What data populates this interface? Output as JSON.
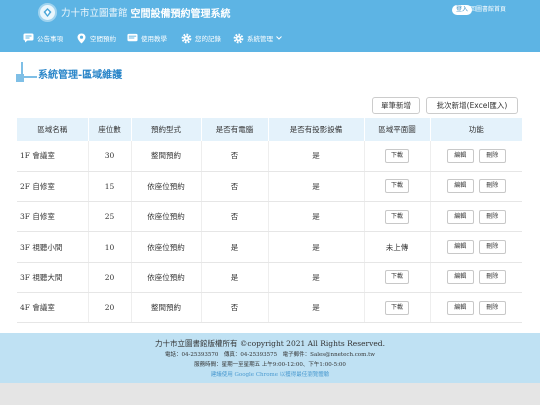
{
  "header": {
    "library_name": "力十市立圖書館",
    "system_name": "空間設備預約管理系統",
    "login_label": "登入",
    "site_link": "回圖書館首頁"
  },
  "nav": [
    {
      "label": "公告事項",
      "icon": "announcement-icon"
    },
    {
      "label": "空間預約",
      "icon": "location-pin-icon"
    },
    {
      "label": "使用教學",
      "icon": "tutorial-icon"
    },
    {
      "label": "您的記錄",
      "icon": "gear-icon"
    },
    {
      "label": "系統管理",
      "icon": "gear-icon"
    }
  ],
  "page": {
    "title": "系統管理-區域維護"
  },
  "actions": {
    "single_add": "單筆新增",
    "batch_add": "批次新增(Excel匯入)"
  },
  "table": {
    "headers": [
      "區域名稱",
      "座位數",
      "預約型式",
      "是否有電腦",
      "是否有投影設備",
      "區域平面圖",
      "功能"
    ],
    "rows": [
      {
        "name": "1F 會議室",
        "seats": "30",
        "type": "整間預約",
        "computer": "否",
        "projector": "是",
        "floorplan": "下載",
        "edit": "編輯",
        "delete": "刪除"
      },
      {
        "name": "2F 自修室",
        "seats": "15",
        "type": "依座位預約",
        "computer": "否",
        "projector": "是",
        "floorplan": "下載",
        "edit": "編輯",
        "delete": "刪除"
      },
      {
        "name": "3F 自修室",
        "seats": "25",
        "type": "依座位預約",
        "computer": "否",
        "projector": "是",
        "floorplan": "下載",
        "edit": "編輯",
        "delete": "刪除"
      },
      {
        "name": "3F 視聽小間",
        "seats": "10",
        "type": "依座位預約",
        "computer": "是",
        "projector": "是",
        "floorplan": "未上傳",
        "edit": "編輯",
        "delete": "刪除"
      },
      {
        "name": "3F 視聽大間",
        "seats": "20",
        "type": "依座位預約",
        "computer": "是",
        "projector": "是",
        "floorplan": "下載",
        "edit": "編輯",
        "delete": "刪除"
      },
      {
        "name": "4F 會議室",
        "seats": "20",
        "type": "整間預約",
        "computer": "否",
        "projector": "是",
        "floorplan": "下載",
        "edit": "編輯",
        "delete": "刪除"
      }
    ]
  },
  "footer": {
    "copyright": "力十市立圖書館版權所有 ©copyright 2021 All Rights Reserved.",
    "contact": "電話：04-25393570　傳真：04-25393575　電子郵件：Sales@nnetech.com.tw",
    "hours": "服務時間：星期一至星期五 上午9:00-12:00、下午1:00-5:00",
    "browser_note": "建議使用 Google Chrome 以獲得最佳瀏覽體驗"
  },
  "colors": {
    "header_bg": "#5db4e4",
    "title_blue": "#2a86c9",
    "table_header_bg": "#e4f2fb",
    "footer_bg": "#bfe1f3"
  }
}
